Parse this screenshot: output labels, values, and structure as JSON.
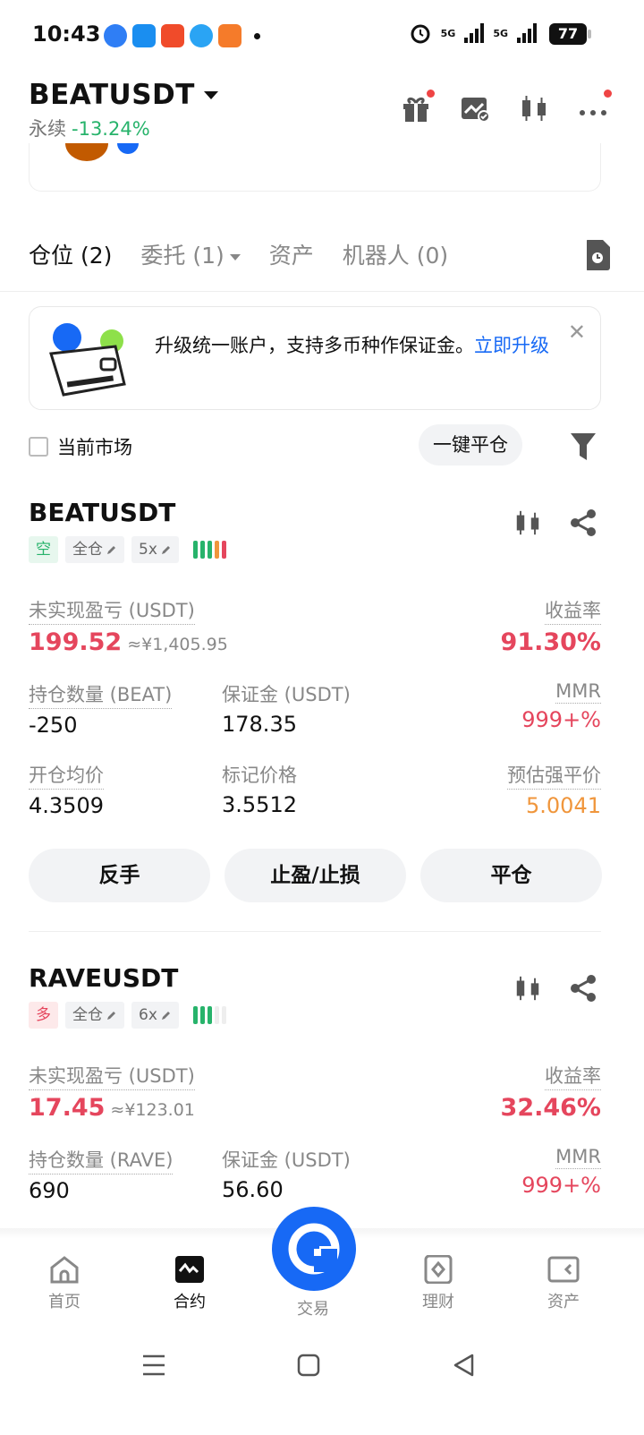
{
  "status": {
    "time": "10:43",
    "battery": "77",
    "net1": "5G",
    "net2": "5G"
  },
  "header": {
    "symbol": "BEATUSDT",
    "type": "永续",
    "change": "-13.24%"
  },
  "tabs": [
    {
      "label": "仓位 (2)",
      "active": true
    },
    {
      "label": "委托 (1)",
      "active": false
    },
    {
      "label": "资产",
      "active": false
    },
    {
      "label": "机器人 (0)",
      "active": false
    }
  ],
  "upgrade": {
    "text": "升级统一账户，支持多币种作保证金。",
    "link": "立即升级"
  },
  "filter": {
    "current_market": "当前市场",
    "close_all": "一键平仓"
  },
  "positions": [
    {
      "symbol": "BEATUSDT",
      "side": "空",
      "margin_mode": "全仓",
      "leverage": "5x",
      "pnl_label": "未实现盈亏 (USDT)",
      "pnl": "199.52",
      "pnl_cny": "≈¥1,405.95",
      "roe_label": "收益率",
      "roe": "91.30%",
      "qty_label": "持仓数量 (BEAT)",
      "qty": "-250",
      "margin_label": "保证金 (USDT)",
      "margin": "178.35",
      "mmr_label": "MMR",
      "mmr": "999+%",
      "entry_label": "开仓均价",
      "entry": "4.3509",
      "mark_label": "标记价格",
      "mark": "3.5512",
      "liq_label": "预估强平价",
      "liq": "5.0041",
      "btn_reverse": "反手",
      "btn_tpsl": "止盈/止损",
      "btn_close": "平仓"
    },
    {
      "symbol": "RAVEUSDT",
      "side": "多",
      "margin_mode": "全仓",
      "leverage": "6x",
      "pnl_label": "未实现盈亏 (USDT)",
      "pnl": "17.45",
      "pnl_cny": "≈¥123.01",
      "roe_label": "收益率",
      "roe": "32.46%",
      "qty_label": "持仓数量 (RAVE)",
      "qty": "690",
      "margin_label": "保证金 (USDT)",
      "margin": "56.60",
      "mmr_label": "MMR",
      "mmr": "999+%"
    }
  ],
  "nav": {
    "home": "首页",
    "contract": "合约",
    "trade": "交易",
    "finance": "理财",
    "assets": "资产"
  },
  "colors": {
    "accent": "#1769f5",
    "red": "#e5465d",
    "green": "#27b36b",
    "orange": "#f0963c"
  }
}
